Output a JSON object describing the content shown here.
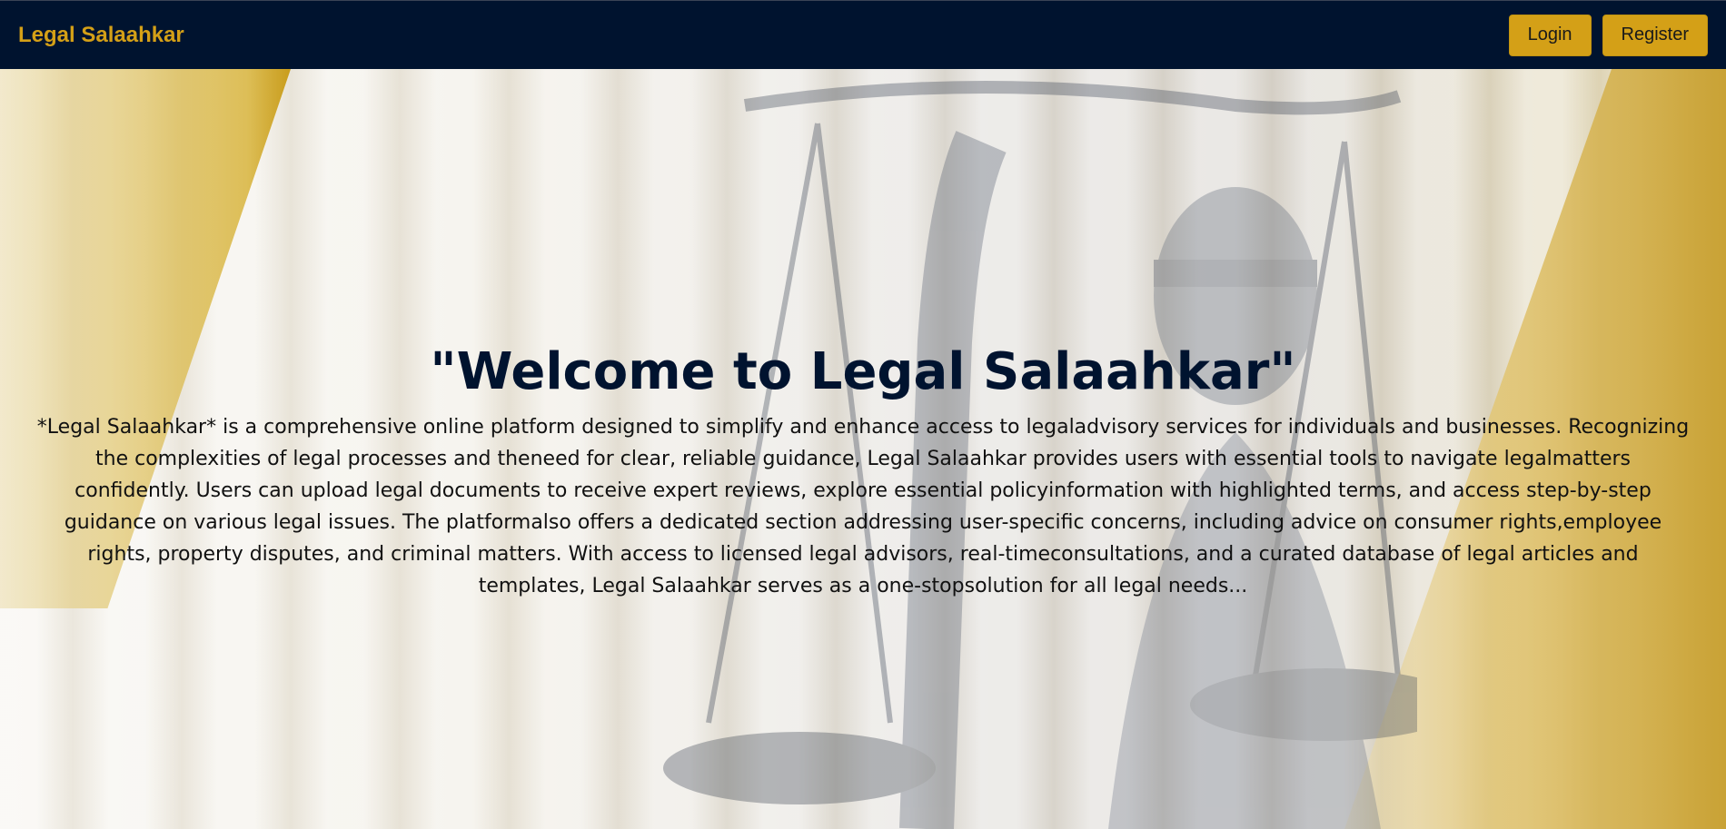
{
  "navbar": {
    "brand": "Legal Salaahkar",
    "login_label": "Login",
    "register_label": "Register"
  },
  "hero": {
    "title": "\"Welcome to Legal Salaahkar\"",
    "description": "*Legal Salaahkar* is a comprehensive online platform designed to simplify and enhance access to legaladvisory services for individuals and businesses. Recognizing the complexities of legal processes and theneed for clear, reliable guidance, Legal Salaahkar provides users with essential tools to navigate legalmatters confidently. Users can upload legal documents to receive expert reviews, explore essential policyinformation with highlighted terms, and access step-by-step guidance on various legal issues. The platformalso offers a dedicated section addressing user-specific concerns, including advice on consumer rights,employee rights, property disputes, and criminal matters. With access to licensed legal advisors, real-timeconsultations, and a curated database of legal articles and templates, Legal Salaahkar serves as a one-stopsolution for all legal needs..."
  },
  "colors": {
    "navbar_bg": "#00132f",
    "accent_gold": "#d4a017",
    "title_navy": "#00132f"
  }
}
